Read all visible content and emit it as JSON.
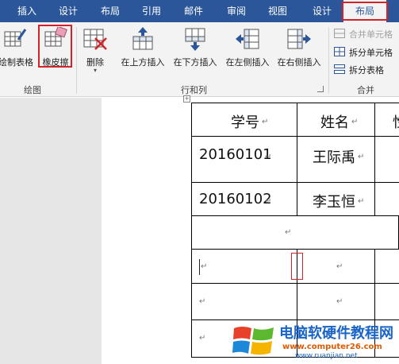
{
  "tabs": [
    {
      "label": "插入",
      "active": false
    },
    {
      "label": "设计",
      "active": false
    },
    {
      "label": "布局",
      "active": false
    },
    {
      "label": "引用",
      "active": false
    },
    {
      "label": "邮件",
      "active": false
    },
    {
      "label": "审阅",
      "active": false
    },
    {
      "label": "视图",
      "active": false
    },
    {
      "label": "设计",
      "active": false
    },
    {
      "label": "布局",
      "active": true
    }
  ],
  "ribbon": {
    "draw_group": {
      "draw_table": "绘制表格",
      "eraser": "橡皮擦",
      "label": "绘图"
    },
    "rows_cols_group": {
      "delete": "删除",
      "insert_above": "在上方插入",
      "insert_below": "在下方插入",
      "insert_left": "在左侧插入",
      "insert_right": "在右侧插入",
      "label": "行和列"
    },
    "merge_group": {
      "merge_cells": "合并单元格",
      "split_cells": "拆分单元格",
      "split_table": "拆分表格",
      "label": "合并"
    }
  },
  "table": {
    "header": [
      "学号",
      "姓名",
      "性"
    ],
    "rows": [
      [
        "20160101",
        "王际禹"
      ],
      [
        "20160102",
        "李玉恒"
      ]
    ],
    "paragraph_mark": "↵"
  },
  "watermark": {
    "title": "电脑软硬件教程网",
    "url_primary": "www.computer26.com",
    "url_secondary": "www.ruanjian.net"
  },
  "colors": {
    "tab_bar": "#2b579a",
    "ribbon": "#f3f3f3",
    "highlight": "#d2232a",
    "watermark_blue": "#1a64c8",
    "watermark_orange": "#e05a00"
  }
}
